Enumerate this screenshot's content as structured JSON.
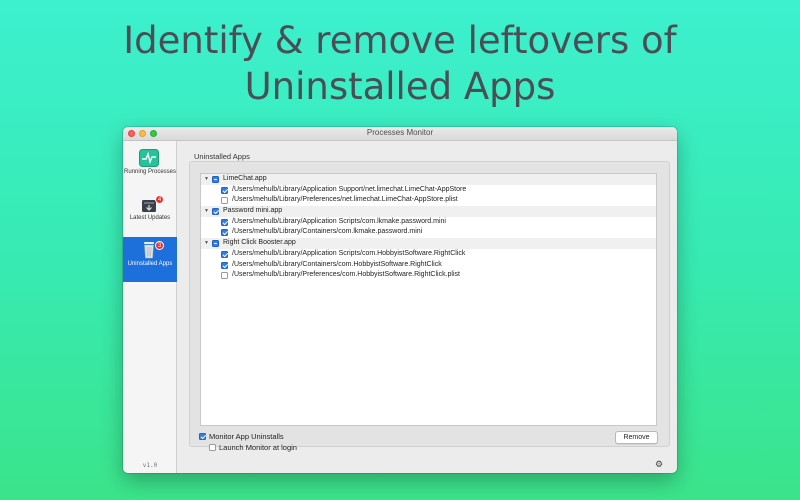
{
  "headline": {
    "line1": "Identify & remove leftovers of",
    "line2": "Uninstalled Apps"
  },
  "window": {
    "title": "Processes Monitor"
  },
  "sidebar": {
    "items": [
      {
        "label": "Running Processes",
        "icon": "activity-monitor-icon",
        "active": false
      },
      {
        "label": "Latest Updates",
        "icon": "download-box-icon",
        "badge": "4",
        "active": false
      },
      {
        "label": "Uninstalled Apps",
        "icon": "trash-icon",
        "badge": "3",
        "active": true
      }
    ],
    "version": "v1.0"
  },
  "main": {
    "section_title": "Uninstalled Apps",
    "apps": [
      {
        "name": "LimeChat.app",
        "state": "mixed",
        "paths": [
          {
            "path": "/Users/mehulb/Library/Application Support/net.limechat.LimeChat-AppStore",
            "checked": true
          },
          {
            "path": "/Users/mehulb/Library/Preferences/net.limechat.LimeChat-AppStore.plist",
            "checked": false
          }
        ]
      },
      {
        "name": "Password mini.app",
        "state": "on",
        "paths": [
          {
            "path": "/Users/mehulb/Library/Application Scripts/com.lkmake.password.mini",
            "checked": true
          },
          {
            "path": "/Users/mehulb/Library/Containers/com.lkmake.password.mini",
            "checked": true
          }
        ]
      },
      {
        "name": "Right Click Booster.app",
        "state": "mixed",
        "paths": [
          {
            "path": "/Users/mehulb/Library/Application Scripts/com.HobbyistSoftware.RightClick",
            "checked": true
          },
          {
            "path": "/Users/mehulb/Library/Containers/com.HobbyistSoftware.RightClick",
            "checked": true
          },
          {
            "path": "/Users/mehulb/Library/Preferences/com.HobbyistSoftware.RightClick.plist",
            "checked": false
          }
        ]
      }
    ],
    "monitor_uninstalls_label": "Monitor App Uninstalls",
    "monitor_uninstalls_checked": true,
    "launch_at_login_label": "Launch Monitor at login",
    "launch_at_login_checked": false,
    "remove_label": "Remove",
    "settings_icon": "gear-icon"
  },
  "colors": {
    "accent": "#1d6fdc",
    "checkbox": "#2f7bf0",
    "background_top": "#3df0cf",
    "background_bottom": "#3be48a",
    "headline_text": "#4a4f55"
  }
}
